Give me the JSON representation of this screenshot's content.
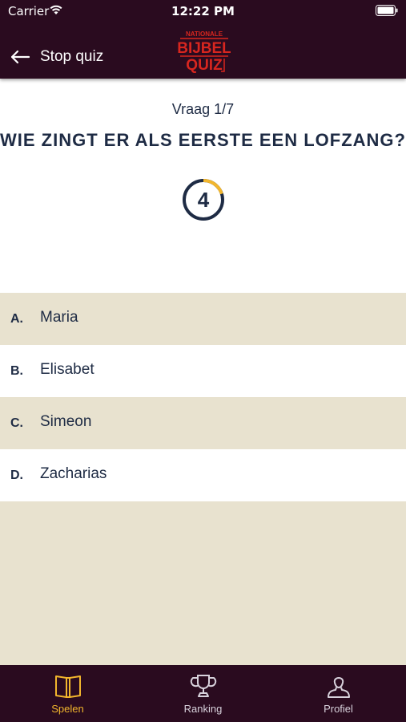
{
  "status_bar": {
    "carrier": "Carrier",
    "time": "12:22 PM"
  },
  "header": {
    "back_label": "Stop quiz",
    "logo": {
      "line1": "NATIONALE",
      "line2": "BIJBEL",
      "line3": "QUIZ"
    }
  },
  "question": {
    "counter": "Vraag 1/7",
    "text": "WIE ZINGT ER ALS EERSTE EEN LOFZANG?",
    "timer_value": "4",
    "timer_progress": 0.2
  },
  "answers": [
    {
      "letter": "A.",
      "text": "Maria"
    },
    {
      "letter": "B.",
      "text": "Elisabet"
    },
    {
      "letter": "C.",
      "text": "Simeon"
    },
    {
      "letter": "D.",
      "text": "Zacharias"
    }
  ],
  "tabs": [
    {
      "label": "Spelen",
      "icon": "book-icon",
      "active": true
    },
    {
      "label": "Ranking",
      "icon": "trophy-icon",
      "active": false
    },
    {
      "label": "Profiel",
      "icon": "user-icon",
      "active": false
    }
  ],
  "colors": {
    "header_bg": "#2a0b1f",
    "accent": "#f2b62d",
    "logo_red": "#d8261f",
    "text_dark": "#1e2b44",
    "shaded_row": "#e8e2cf"
  }
}
